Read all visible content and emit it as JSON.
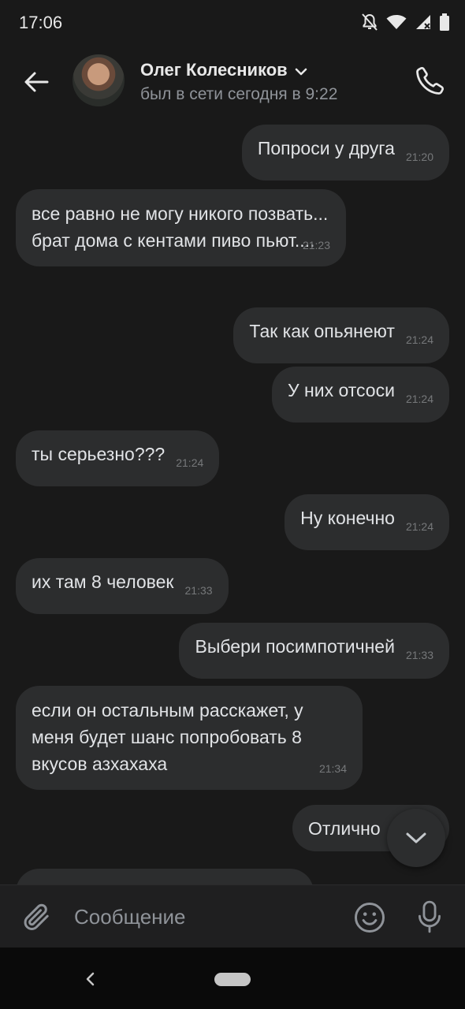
{
  "status_bar": {
    "time": "17:06"
  },
  "header": {
    "contact_name": "Олег Колесников",
    "contact_status": "был в сети сегодня в 9:22"
  },
  "messages": [
    {
      "dir": "out",
      "text": "Попроси у друга",
      "time": "21:20"
    },
    {
      "dir": "in",
      "text": "все равно не могу никого позвать... брат дома с кентами пиво пьют....",
      "time": "21:23"
    },
    {
      "dir": "out",
      "text": "Так как опьянеют",
      "time": "21:24"
    },
    {
      "dir": "out",
      "text": "У них отсоси",
      "time": "21:24"
    },
    {
      "dir": "in",
      "text": "ты серьезно???",
      "time": "21:24"
    },
    {
      "dir": "out",
      "text": "Ну конечно",
      "time": "21:24"
    },
    {
      "dir": "in",
      "text": "их там 8 человек",
      "time": "21:33"
    },
    {
      "dir": "out",
      "text": "Выбери посимпотичней",
      "time": "21:33"
    },
    {
      "dir": "in",
      "text": "если он остальным расскажет, у меня будет шанс попробовать 8 вкусов азхахаха",
      "time": "21:34"
    },
    {
      "dir": "out",
      "text": "Отлично",
      "time": ""
    }
  ],
  "composer": {
    "placeholder": "Сообщение"
  },
  "colors": {
    "background": "#191919",
    "bubble": "#2c2d2e",
    "text": "#e1e3e6",
    "secondary": "#8f9399"
  }
}
